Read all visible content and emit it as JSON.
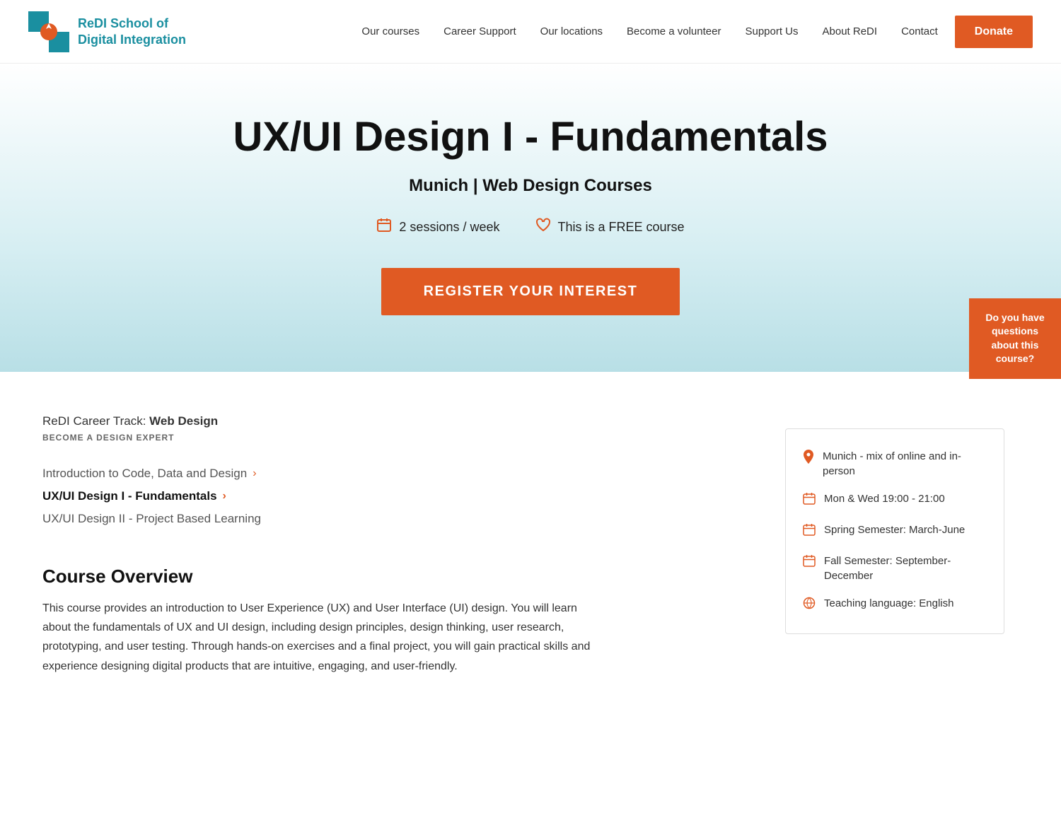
{
  "navbar": {
    "logo_text_line1": "ReDI School of",
    "logo_text_line2": "Digital Integration",
    "nav_items": [
      {
        "label": "Our courses",
        "href": "#"
      },
      {
        "label": "Career Support",
        "href": "#"
      },
      {
        "label": "Our locations",
        "href": "#"
      },
      {
        "label": "Become a volunteer",
        "href": "#"
      },
      {
        "label": "Support Us",
        "href": "#"
      },
      {
        "label": "About ReDI",
        "href": "#"
      },
      {
        "label": "Contact",
        "href": "#"
      }
    ],
    "donate_label": "Donate"
  },
  "hero": {
    "title": "UX/UI Design I - Fundamentals",
    "subtitle": "Munich | Web Design Courses",
    "sessions_label": "2 sessions / week",
    "free_label": "This is a FREE course",
    "register_label": "REGISTER YOUR INTEREST",
    "questions_label": "Do you have questions about this course?"
  },
  "career_track": {
    "prefix": "ReDI Career Track: ",
    "track_name": "Web Design",
    "subtitle": "BECOME A DESIGN EXPERT",
    "courses": [
      {
        "label": "Introduction to Code, Data and Design",
        "active": false
      },
      {
        "label": "UX/UI Design I - Fundamentals",
        "active": true
      },
      {
        "label": "UX/UI Design II - Project Based Learning",
        "active": false
      }
    ]
  },
  "course_overview": {
    "title": "Course Overview",
    "text": "This course provides an introduction to User Experience (UX) and User Interface (UI) design. You will learn about the fundamentals of UX and UI design, including design principles, design thinking, user research, prototyping, and user testing. Through hands-on exercises and a final project, you will gain practical skills and experience designing digital products that are intuitive, engaging, and user-friendly."
  },
  "info_card": {
    "items": [
      {
        "icon": "📍",
        "text": "Munich - mix of online and in-person"
      },
      {
        "icon": "📅",
        "text": "Mon & Wed 19:00 - 21:00"
      },
      {
        "icon": "📅",
        "text": "Spring Semester: March-June"
      },
      {
        "icon": "📅",
        "text": "Fall Semester: September-December"
      },
      {
        "icon": "💬",
        "text": "Teaching language: English"
      }
    ]
  },
  "colors": {
    "accent": "#e05a23",
    "primary_text": "#111",
    "muted_text": "#555",
    "link": "#333",
    "hero_bg_end": "#b8dfe6"
  }
}
